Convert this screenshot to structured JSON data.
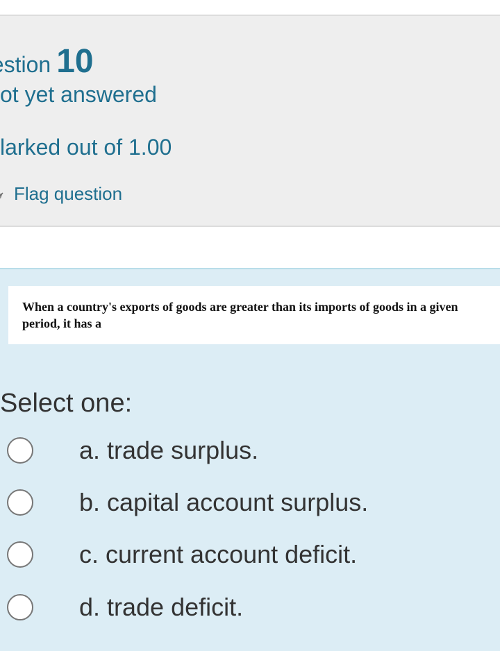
{
  "question_info": {
    "heading_word": "uestion",
    "number": "10",
    "state": "ot yet answered",
    "grade": "larked out of 1.00",
    "flag_icon": "flag-icon",
    "flag_label": "Flag question"
  },
  "question": {
    "text": "When a country's exports of goods are greater than its imports of goods in a given period, it has a",
    "prompt": "Select one:",
    "options": [
      {
        "label": "a. trade surplus.",
        "selected": false
      },
      {
        "label": "b. capital account surplus.",
        "selected": false
      },
      {
        "label": "c. current account deficit.",
        "selected": false
      },
      {
        "label": "d. trade deficit.",
        "selected": false
      }
    ]
  },
  "colors": {
    "info_background": "#eeeeee",
    "info_text": "#1f6f8f",
    "content_background": "#dcedf5",
    "content_border": "#b9dde9",
    "option_text": "#333333"
  }
}
